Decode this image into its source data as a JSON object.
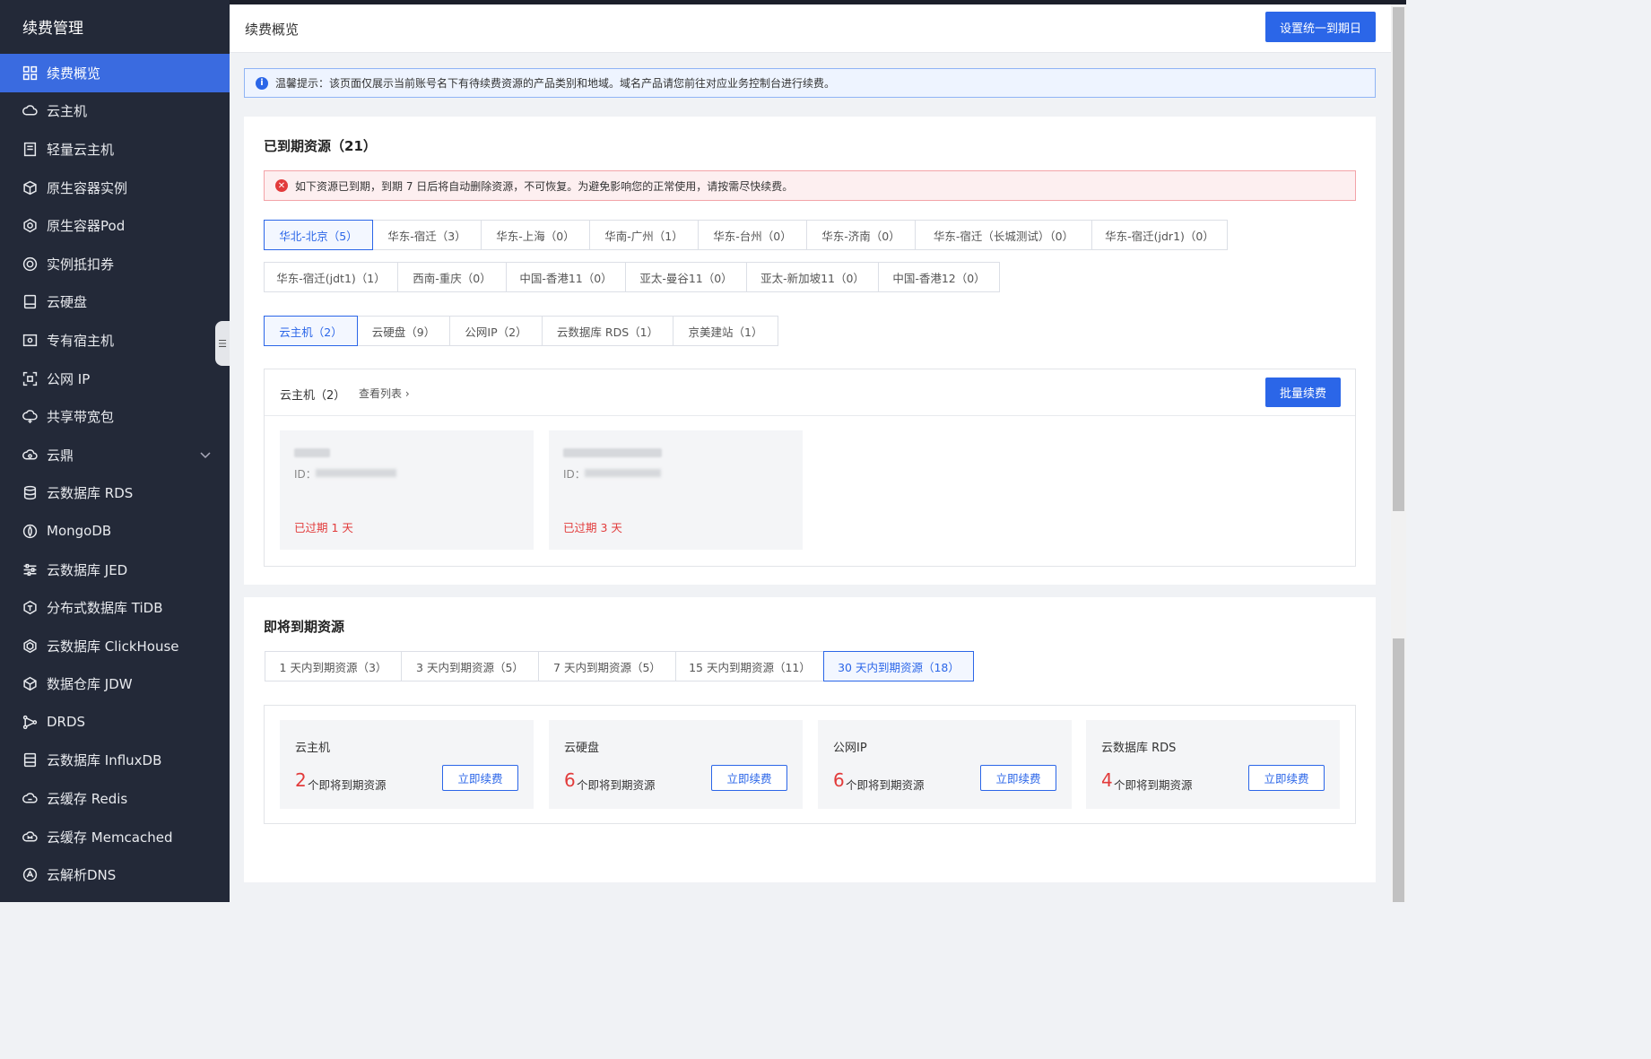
{
  "sidebar": {
    "title": "续费管理",
    "items": [
      {
        "label": "续费概览",
        "icon": "dashboard-icon"
      },
      {
        "label": "云主机",
        "icon": "cloud-server-icon"
      },
      {
        "label": "轻量云主机",
        "icon": "lightweight-server-icon"
      },
      {
        "label": "原生容器实例",
        "icon": "container-icon"
      },
      {
        "label": "原生容器Pod",
        "icon": "pod-icon"
      },
      {
        "label": "实例抵扣券",
        "icon": "coupon-icon"
      },
      {
        "label": "云硬盘",
        "icon": "disk-icon"
      },
      {
        "label": "专有宿主机",
        "icon": "dedicated-host-icon"
      },
      {
        "label": "公网 IP",
        "icon": "public-ip-icon"
      },
      {
        "label": "共享带宽包",
        "icon": "bandwidth-icon"
      },
      {
        "label": "云鼎",
        "icon": "cloud-ding-icon"
      },
      {
        "label": "云数据库 RDS",
        "icon": "database-icon"
      },
      {
        "label": "MongoDB",
        "icon": "mongodb-icon"
      },
      {
        "label": "云数据库 JED",
        "icon": "sliders-icon"
      },
      {
        "label": "分布式数据库 TiDB",
        "icon": "tidb-icon"
      },
      {
        "label": "云数据库 ClickHouse",
        "icon": "clickhouse-icon"
      },
      {
        "label": "数据仓库 JDW",
        "icon": "warehouse-icon"
      },
      {
        "label": "DRDS",
        "icon": "drds-icon"
      },
      {
        "label": "云数据库 InfluxDB",
        "icon": "influxdb-icon"
      },
      {
        "label": "云缓存 Redis",
        "icon": "redis-icon"
      },
      {
        "label": "云缓存 Memcached",
        "icon": "memcached-icon"
      },
      {
        "label": "云解析DNS",
        "icon": "dns-icon"
      }
    ]
  },
  "header": {
    "title": "续费概览",
    "set_date_button": "设置统一到期日"
  },
  "info_banner": {
    "icon": "info-icon",
    "text": "温馨提示：该页面仅展示当前账号名下有待续费资源的产品类别和地域。域名产品请您前往对应业务控制台进行续费。"
  },
  "expired": {
    "title": "已到期资源（21）",
    "warning": "如下资源已到期，到期 7 日后将自动删除资源，不可恢复。为避免影响您的正常使用，请按需尽快续费。",
    "regions_row1": [
      "华北-北京（5）",
      "华东-宿迁（3）",
      "华东-上海（0）",
      "华南-广州（1）",
      "华东-台州（0）",
      "华东-济南（0）",
      "华东-宿迁（长城测试）（0）",
      "华东-宿迁(jdr1)（0）"
    ],
    "regions_row2": [
      "华东-宿迁(jdt1)（1）",
      "西南-重庆（0）",
      "中国-香港11（0）",
      "亚太-曼谷11（0）",
      "亚太-新加坡11（0）",
      "中国-香港12（0）"
    ],
    "products": [
      "云主机（2）",
      "云硬盘（9）",
      "公网IP（2）",
      "云数据库 RDS（1）",
      "京美建站（1）"
    ],
    "list": {
      "label": "云主机（2）",
      "view_link": "查看列表",
      "batch_button": "批量续费",
      "cards": [
        {
          "id_label": "ID：",
          "status": "已过期 1 天"
        },
        {
          "id_label": "ID：",
          "status": "已过期 3 天"
        }
      ]
    }
  },
  "upcoming": {
    "title": "即将到期资源",
    "tabs": [
      "1 天内到期资源（3）",
      "3 天内到期资源（5）",
      "7 天内到期资源（5）",
      "15 天内到期资源（11）",
      "30 天内到期资源（18）"
    ],
    "count_suffix": "个即将到期资源",
    "renew_button": "立即续费",
    "cards": [
      {
        "title": "云主机",
        "count": "2"
      },
      {
        "title": "云硬盘",
        "count": "6"
      },
      {
        "title": "公网IP",
        "count": "6"
      },
      {
        "title": "云数据库 RDS",
        "count": "4"
      }
    ]
  }
}
